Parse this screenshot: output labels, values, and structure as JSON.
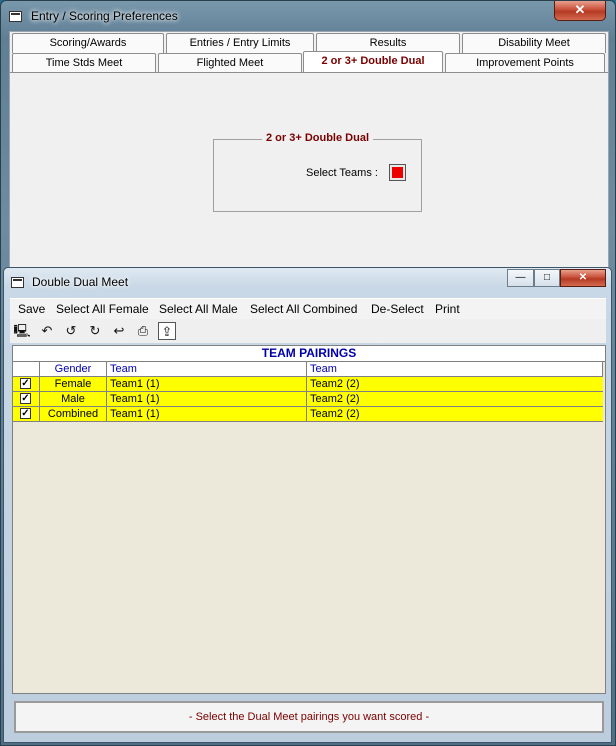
{
  "prefs_window": {
    "title": "Entry / Scoring Preferences",
    "close_label": "✕",
    "tabs_row1": [
      "Scoring/Awards",
      "Entries / Entry Limits",
      "Results",
      "Disability Meet"
    ],
    "tabs_row2": [
      "Time Stds Meet",
      "Flighted Meet",
      "2 or 3+ Double Dual",
      "Improvement Points"
    ],
    "active_tab": "2 or 3+ Double Dual",
    "group_title": "2 or 3+ Double Dual",
    "select_teams_label": "Select Teams :"
  },
  "dual_window": {
    "title": "Double Dual Meet",
    "minimize_label": "—",
    "maximize_label": "□",
    "close_label": "✕",
    "menu": [
      "Save",
      "Select All Female",
      "Select All Male",
      "Select All Combined",
      "De-Select",
      "Print"
    ],
    "toolbar_icons": [
      "computer-icon",
      "undo-icon",
      "undo-all-icon",
      "redo-icon",
      "revert-icon",
      "printer-icon",
      "exit-icon"
    ],
    "grid": {
      "title": "TEAM PAIRINGS",
      "columns": [
        "",
        "Gender",
        "Team",
        "Team"
      ],
      "rows": [
        {
          "checked": true,
          "gender": "Female",
          "team1": "Team1 (1)",
          "team2": "Team2 (2)"
        },
        {
          "checked": true,
          "gender": "Male",
          "team1": "Team1 (1)",
          "team2": "Team2 (2)"
        },
        {
          "checked": true,
          "gender": "Combined",
          "team1": "Team1 (1)",
          "team2": "Team2 (2)"
        }
      ]
    },
    "status": "- Select the Dual Meet pairings you want scored -",
    "colors": {
      "row_highlight": "#ffff00",
      "header_text": "#0000aa",
      "accent_text": "#7a0000"
    }
  }
}
